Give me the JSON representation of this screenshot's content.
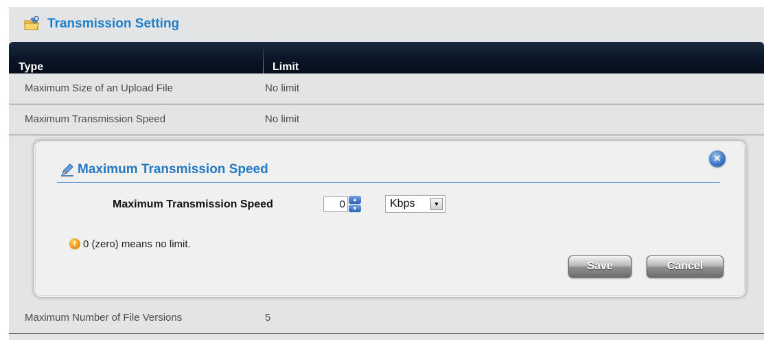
{
  "section": {
    "title": "Transmission Setting",
    "icon": "folder-wrench-icon"
  },
  "table": {
    "columns": [
      "Type",
      "Limit"
    ],
    "rows": [
      {
        "type": "Maximum Size of an Upload File",
        "limit": "No limit"
      },
      {
        "type": "Maximum Transmission Speed",
        "limit": "No limit"
      },
      {
        "type": "Maximum Number of File Versions",
        "limit": "5"
      }
    ]
  },
  "dialog": {
    "title": "Maximum Transmission Speed",
    "field_label": "Maximum Transmission Speed",
    "speed_value": "0",
    "unit_selected": "Kbps",
    "note": "0 (zero) means no limit.",
    "save_label": "Save",
    "cancel_label": "Cancel",
    "close_icon": "close-icon",
    "note_icon": "info-icon"
  },
  "colors": {
    "accent_blue": "#1e7fc8",
    "header_dark": "#0a1526",
    "panel_bg": "#e3e4e6"
  }
}
